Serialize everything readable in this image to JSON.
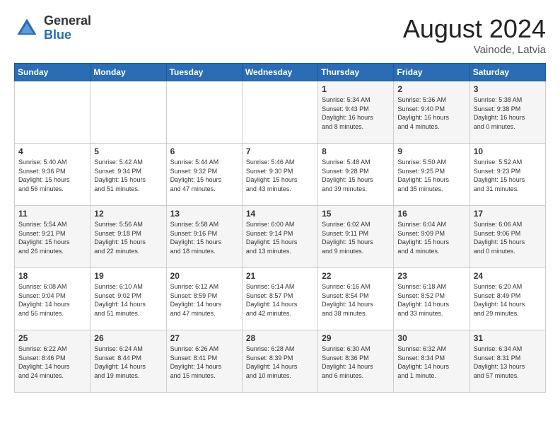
{
  "logo": {
    "general": "General",
    "blue": "Blue"
  },
  "title": "August 2024",
  "location": "Vainode, Latvia",
  "days_of_week": [
    "Sunday",
    "Monday",
    "Tuesday",
    "Wednesday",
    "Thursday",
    "Friday",
    "Saturday"
  ],
  "weeks": [
    [
      {
        "day": "",
        "info": ""
      },
      {
        "day": "",
        "info": ""
      },
      {
        "day": "",
        "info": ""
      },
      {
        "day": "",
        "info": ""
      },
      {
        "day": "1",
        "info": "Sunrise: 5:34 AM\nSunset: 9:43 PM\nDaylight: 16 hours\nand 8 minutes."
      },
      {
        "day": "2",
        "info": "Sunrise: 5:36 AM\nSunset: 9:40 PM\nDaylight: 16 hours\nand 4 minutes."
      },
      {
        "day": "3",
        "info": "Sunrise: 5:38 AM\nSunset: 9:38 PM\nDaylight: 16 hours\nand 0 minutes."
      }
    ],
    [
      {
        "day": "4",
        "info": "Sunrise: 5:40 AM\nSunset: 9:36 PM\nDaylight: 15 hours\nand 56 minutes."
      },
      {
        "day": "5",
        "info": "Sunrise: 5:42 AM\nSunset: 9:34 PM\nDaylight: 15 hours\nand 51 minutes."
      },
      {
        "day": "6",
        "info": "Sunrise: 5:44 AM\nSunset: 9:32 PM\nDaylight: 15 hours\nand 47 minutes."
      },
      {
        "day": "7",
        "info": "Sunrise: 5:46 AM\nSunset: 9:30 PM\nDaylight: 15 hours\nand 43 minutes."
      },
      {
        "day": "8",
        "info": "Sunrise: 5:48 AM\nSunset: 9:28 PM\nDaylight: 15 hours\nand 39 minutes."
      },
      {
        "day": "9",
        "info": "Sunrise: 5:50 AM\nSunset: 9:25 PM\nDaylight: 15 hours\nand 35 minutes."
      },
      {
        "day": "10",
        "info": "Sunrise: 5:52 AM\nSunset: 9:23 PM\nDaylight: 15 hours\nand 31 minutes."
      }
    ],
    [
      {
        "day": "11",
        "info": "Sunrise: 5:54 AM\nSunset: 9:21 PM\nDaylight: 15 hours\nand 26 minutes."
      },
      {
        "day": "12",
        "info": "Sunrise: 5:56 AM\nSunset: 9:18 PM\nDaylight: 15 hours\nand 22 minutes."
      },
      {
        "day": "13",
        "info": "Sunrise: 5:58 AM\nSunset: 9:16 PM\nDaylight: 15 hours\nand 18 minutes."
      },
      {
        "day": "14",
        "info": "Sunrise: 6:00 AM\nSunset: 9:14 PM\nDaylight: 15 hours\nand 13 minutes."
      },
      {
        "day": "15",
        "info": "Sunrise: 6:02 AM\nSunset: 9:11 PM\nDaylight: 15 hours\nand 9 minutes."
      },
      {
        "day": "16",
        "info": "Sunrise: 6:04 AM\nSunset: 9:09 PM\nDaylight: 15 hours\nand 4 minutes."
      },
      {
        "day": "17",
        "info": "Sunrise: 6:06 AM\nSunset: 9:06 PM\nDaylight: 15 hours\nand 0 minutes."
      }
    ],
    [
      {
        "day": "18",
        "info": "Sunrise: 6:08 AM\nSunset: 9:04 PM\nDaylight: 14 hours\nand 56 minutes."
      },
      {
        "day": "19",
        "info": "Sunrise: 6:10 AM\nSunset: 9:02 PM\nDaylight: 14 hours\nand 51 minutes."
      },
      {
        "day": "20",
        "info": "Sunrise: 6:12 AM\nSunset: 8:59 PM\nDaylight: 14 hours\nand 47 minutes."
      },
      {
        "day": "21",
        "info": "Sunrise: 6:14 AM\nSunset: 8:57 PM\nDaylight: 14 hours\nand 42 minutes."
      },
      {
        "day": "22",
        "info": "Sunrise: 6:16 AM\nSunset: 8:54 PM\nDaylight: 14 hours\nand 38 minutes."
      },
      {
        "day": "23",
        "info": "Sunrise: 6:18 AM\nSunset: 8:52 PM\nDaylight: 14 hours\nand 33 minutes."
      },
      {
        "day": "24",
        "info": "Sunrise: 6:20 AM\nSunset: 8:49 PM\nDaylight: 14 hours\nand 29 minutes."
      }
    ],
    [
      {
        "day": "25",
        "info": "Sunrise: 6:22 AM\nSunset: 8:46 PM\nDaylight: 14 hours\nand 24 minutes."
      },
      {
        "day": "26",
        "info": "Sunrise: 6:24 AM\nSunset: 8:44 PM\nDaylight: 14 hours\nand 19 minutes."
      },
      {
        "day": "27",
        "info": "Sunrise: 6:26 AM\nSunset: 8:41 PM\nDaylight: 14 hours\nand 15 minutes."
      },
      {
        "day": "28",
        "info": "Sunrise: 6:28 AM\nSunset: 8:39 PM\nDaylight: 14 hours\nand 10 minutes."
      },
      {
        "day": "29",
        "info": "Sunrise: 6:30 AM\nSunset: 8:36 PM\nDaylight: 14 hours\nand 6 minutes."
      },
      {
        "day": "30",
        "info": "Sunrise: 6:32 AM\nSunset: 8:34 PM\nDaylight: 14 hours\nand 1 minute."
      },
      {
        "day": "31",
        "info": "Sunrise: 6:34 AM\nSunset: 8:31 PM\nDaylight: 13 hours\nand 57 minutes."
      }
    ]
  ]
}
